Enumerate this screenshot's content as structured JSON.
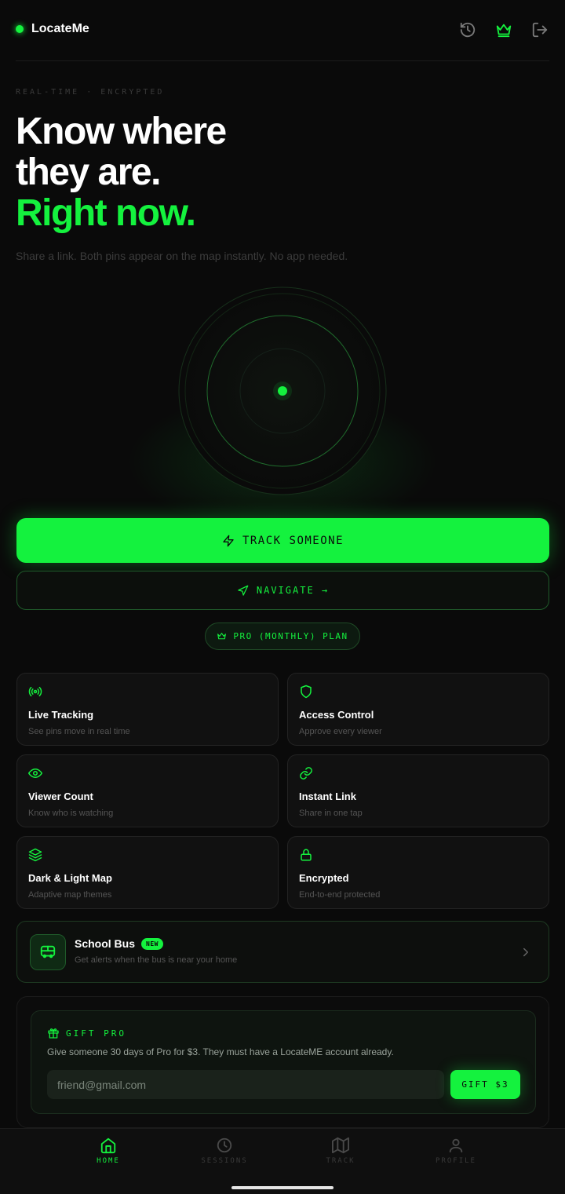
{
  "app": {
    "name": "LocateMe",
    "accent": "#14f23e"
  },
  "header": {
    "icons": [
      "history-icon",
      "crown-icon",
      "logout-icon"
    ]
  },
  "hero": {
    "eyebrow": "REAL-TIME · ENCRYPTED",
    "title_line1": "Know where",
    "title_line2": "they are.",
    "title_line3": "Right now.",
    "subtitle": "Share a link. Both pins appear on the map instantly. No app needed."
  },
  "actions": {
    "track_label": "TRACK SOMEONE",
    "navigate_label": "NAVIGATE →",
    "plan_label": "PRO (MONTHLY) PLAN"
  },
  "features": [
    {
      "icon": "broadcast-icon",
      "title": "Live Tracking",
      "subtitle": "See pins move in real time"
    },
    {
      "icon": "shield-icon",
      "title": "Access Control",
      "subtitle": "Approve every viewer"
    },
    {
      "icon": "eye-icon",
      "title": "Viewer Count",
      "subtitle": "Know who is watching"
    },
    {
      "icon": "link-icon",
      "title": "Instant Link",
      "subtitle": "Share in one tap"
    },
    {
      "icon": "layers-icon",
      "title": "Dark & Light Map",
      "subtitle": "Adaptive map themes"
    },
    {
      "icon": "lock-icon",
      "title": "Encrypted",
      "subtitle": "End-to-end protected"
    }
  ],
  "school_bus": {
    "title": "School Bus",
    "badge": "NEW",
    "subtitle": "Get alerts when the bus is near your home"
  },
  "gift": {
    "heading": "GIFT PRO",
    "description": "Give someone 30 days of Pro for $3. They must have a LocateME account already.",
    "input_placeholder": "friend@gmail.com",
    "button_label": "GIFT $3"
  },
  "bottom_nav": [
    {
      "label": "HOME",
      "icon": "home-icon",
      "active": true
    },
    {
      "label": "SESSIONS",
      "icon": "clock-icon",
      "active": false
    },
    {
      "label": "TRACK",
      "icon": "map-icon",
      "active": false
    },
    {
      "label": "PROFILE",
      "icon": "user-icon",
      "active": false
    }
  ]
}
